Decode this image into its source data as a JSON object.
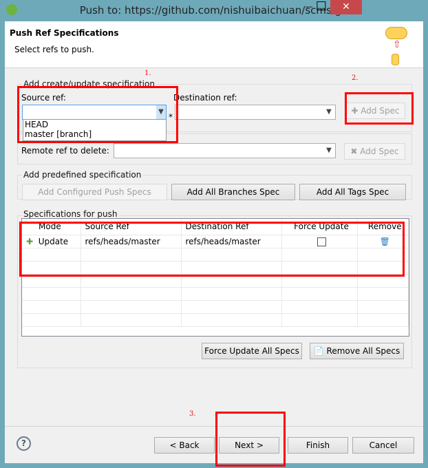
{
  "window": {
    "title": "Push to: https://github.com/nishuibaichuan/scms.git",
    "minimize": "—",
    "maximize": "☐",
    "close": "✕"
  },
  "header": {
    "title": "Push Ref Specifications",
    "subtitle": "Select refs to push."
  },
  "create_group": {
    "title": "Add create/update specification",
    "source_label": "Source ref:",
    "dest_label": "Destination ref:",
    "add_spec": "Add Spec",
    "options": [
      "HEAD",
      "master [branch]"
    ]
  },
  "delete_group": {
    "remote_label": "Remote ref to delete:",
    "add_spec": "Add Spec"
  },
  "predefined": {
    "title": "Add predefined specification",
    "configured": "Add Configured Push Specs",
    "branches": "Add All Branches Spec",
    "tags": "Add All Tags Spec"
  },
  "specs": {
    "title": "Specifications for push",
    "columns": [
      "Mode",
      "Source Ref",
      "Destination Ref",
      "Force Update",
      "Remove"
    ],
    "rows": [
      {
        "mode": "Update",
        "source": "refs/heads/master",
        "dest": "refs/heads/master",
        "force": false
      }
    ],
    "force_all": "Force Update All Specs",
    "remove_all": "Remove All Specs"
  },
  "annotations": {
    "one": "1.",
    "two": "2.",
    "three": "3."
  },
  "footer": {
    "back": "< Back",
    "next": "Next >",
    "finish": "Finish",
    "cancel": "Cancel",
    "help": "?"
  }
}
